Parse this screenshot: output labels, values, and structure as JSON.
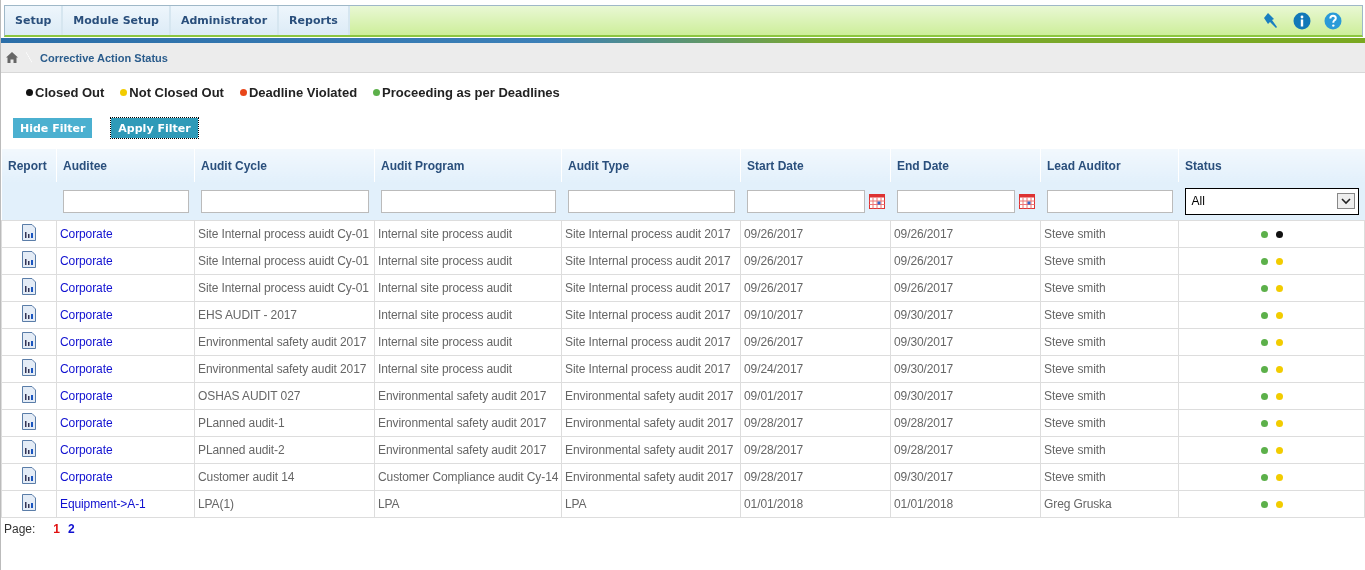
{
  "menu": [
    {
      "label": "Setup"
    },
    {
      "label": "Module Setup"
    },
    {
      "label": "Administrator"
    },
    {
      "label": "Reports"
    }
  ],
  "breadcrumb": "Corrective Action Status",
  "legend": [
    {
      "label": "Closed Out",
      "color": "#111111"
    },
    {
      "label": "Not Closed Out",
      "color": "#f2cc00"
    },
    {
      "label": "Deadline Violated",
      "color": "#e8461a"
    },
    {
      "label": "Proceeding as per Deadlines",
      "color": "#5cb04a"
    }
  ],
  "buttons": [
    {
      "label": "Hide Filter",
      "selected": false
    },
    {
      "label": "Apply Filter",
      "selected": true
    }
  ],
  "table": {
    "columns": [
      {
        "label": "Report",
        "kind": "none"
      },
      {
        "label": "Auditee",
        "kind": "text"
      },
      {
        "label": "Audit Cycle",
        "kind": "text"
      },
      {
        "label": "Audit Program",
        "kind": "text"
      },
      {
        "label": "Audit Type",
        "kind": "text"
      },
      {
        "label": "Start Date",
        "kind": "date"
      },
      {
        "label": "End Date",
        "kind": "date"
      },
      {
        "label": "Lead Auditor",
        "kind": "text"
      },
      {
        "label": "Status",
        "kind": "select",
        "value": "All"
      }
    ],
    "rows": [
      {
        "auditee": "Corporate",
        "cycle": "Site Internal process auidt Cy-01",
        "program": "Internal site process audit",
        "type": "Site Internal process audit 2017",
        "start": "09/26/2017",
        "end": "09/26/2017",
        "lead": "Steve smith",
        "status": [
          {
            "color": "#5cb04a"
          },
          {
            "color": "#111111"
          }
        ]
      },
      {
        "auditee": "Corporate",
        "cycle": "Site Internal process auidt Cy-01",
        "program": "Internal site process audit",
        "type": "Site Internal process audit 2017",
        "start": "09/26/2017",
        "end": "09/26/2017",
        "lead": "Steve smith",
        "status": [
          {
            "color": "#5cb04a"
          },
          {
            "color": "#f2cc00"
          }
        ]
      },
      {
        "auditee": "Corporate",
        "cycle": "Site Internal process auidt Cy-01",
        "program": "Internal site process audit",
        "type": "Site Internal process audit 2017",
        "start": "09/26/2017",
        "end": "09/26/2017",
        "lead": "Steve smith",
        "status": [
          {
            "color": "#5cb04a"
          },
          {
            "color": "#f2cc00"
          }
        ]
      },
      {
        "auditee": "Corporate",
        "cycle": "EHS AUDIT - 2017",
        "program": "Internal site process audit",
        "type": "Site Internal process audit 2017",
        "start": "09/10/2017",
        "end": "09/30/2017",
        "lead": "Steve smith",
        "status": [
          {
            "color": "#5cb04a"
          },
          {
            "color": "#f2cc00"
          }
        ]
      },
      {
        "auditee": "Corporate",
        "cycle": "Environmental safety audit 2017",
        "program": "Internal site process audit",
        "type": "Site Internal process audit 2017",
        "start": "09/26/2017",
        "end": "09/30/2017",
        "lead": "Steve smith",
        "status": [
          {
            "color": "#5cb04a"
          },
          {
            "color": "#f2cc00"
          }
        ]
      },
      {
        "auditee": "Corporate",
        "cycle": "Environmental safety audit 2017",
        "program": "Internal site process audit",
        "type": "Site Internal process audit 2017",
        "start": "09/24/2017",
        "end": "09/30/2017",
        "lead": "Steve smith",
        "status": [
          {
            "color": "#5cb04a"
          },
          {
            "color": "#f2cc00"
          }
        ]
      },
      {
        "auditee": "Corporate",
        "cycle": "OSHAS AUDIT 027",
        "program": "Environmental safety audit 2017",
        "type": "Environmental safety audit 2017",
        "start": "09/01/2017",
        "end": "09/30/2017",
        "lead": "Steve smith",
        "status": [
          {
            "color": "#5cb04a"
          },
          {
            "color": "#f2cc00"
          }
        ]
      },
      {
        "auditee": "Corporate",
        "cycle": "PLanned audit-1",
        "program": "Environmental safety audit 2017",
        "type": "Environmental safety audit 2017",
        "start": "09/28/2017",
        "end": "09/28/2017",
        "lead": "Steve smith",
        "status": [
          {
            "color": "#5cb04a"
          },
          {
            "color": "#f2cc00"
          }
        ]
      },
      {
        "auditee": "Corporate",
        "cycle": "PLanned audit-2",
        "program": "Environmental safety audit 2017",
        "type": "Environmental safety audit 2017",
        "start": "09/28/2017",
        "end": "09/28/2017",
        "lead": "Steve smith",
        "status": [
          {
            "color": "#5cb04a"
          },
          {
            "color": "#f2cc00"
          }
        ]
      },
      {
        "auditee": "Corporate",
        "cycle": "Customer audit 14",
        "program": "Customer Compliance audit Cy-14",
        "type": "Environmental safety audit 2017",
        "start": "09/28/2017",
        "end": "09/30/2017",
        "lead": "Steve smith",
        "status": [
          {
            "color": "#5cb04a"
          },
          {
            "color": "#f2cc00"
          }
        ]
      },
      {
        "auditee": "Equipment->A-1",
        "cycle": "LPA(1)",
        "program": "LPA",
        "type": "LPA",
        "start": "01/01/2018",
        "end": "01/01/2018",
        "lead": "Greg Gruska",
        "status": [
          {
            "color": "#5cb04a"
          },
          {
            "color": "#f2cc00"
          }
        ]
      }
    ]
  },
  "pager": {
    "label": "Page:",
    "pages": [
      {
        "label": "1",
        "selected": true
      },
      {
        "label": "2",
        "selected": false
      }
    ]
  }
}
